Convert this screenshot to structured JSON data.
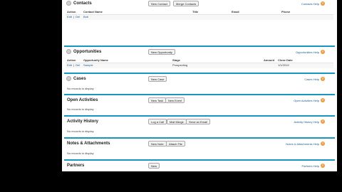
{
  "contacts": {
    "title": "Contacts",
    "buttons": [
      "New Contact",
      "Merge Contacts"
    ],
    "help": "Contacts Help",
    "columns": [
      "Action",
      "Contact Name",
      "Title",
      "Email",
      "Phone"
    ],
    "row": {
      "action_edit": "Edit",
      "action_del": "Del",
      "name": "Bob"
    }
  },
  "opportunities": {
    "title": "Opportunities",
    "buttons": [
      "New Opportunity"
    ],
    "help": "Opportunities Help",
    "columns": [
      "Action",
      "Opportunity Name",
      "Stage",
      "Amount",
      "Close Date"
    ],
    "row": {
      "action_edit": "Edit",
      "action_del": "Del",
      "name": "Sample",
      "stage": "Prospecting",
      "close_date": "1/1/2019"
    }
  },
  "cases": {
    "title": "Cases",
    "buttons": [
      "New Case"
    ],
    "help": "Cases Help",
    "empty": "No records to display"
  },
  "open_activities": {
    "title": "Open Activities",
    "buttons": [
      "New Task",
      "New Event"
    ],
    "help": "Open Activities Help",
    "empty": "No records to display"
  },
  "activity_history": {
    "title": "Activity History",
    "buttons": [
      "Log a Call",
      "Mail Merge",
      "Send an Email"
    ],
    "help": "Activity History Help",
    "empty": "No records to display"
  },
  "notes": {
    "title": "Notes & Attachments",
    "buttons": [
      "New Note",
      "Attach File"
    ],
    "help": "Notes & Attachments Help",
    "empty": "No records to display"
  },
  "partners": {
    "title": "Partners",
    "buttons": [
      "New"
    ],
    "help": "Partners Help"
  },
  "help_icon_glyph": "?",
  "colors": {
    "accent": "#1797c0",
    "help_icon": "#e9a043",
    "link": "#1a5a96"
  }
}
